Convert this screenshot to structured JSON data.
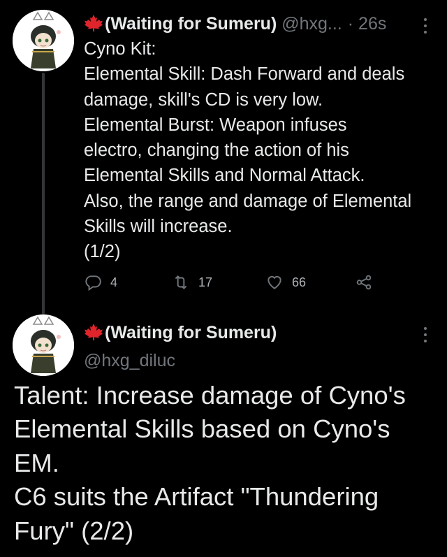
{
  "colors": {
    "background": "#000000",
    "text": "#e7e9ea",
    "secondary": "#71767b",
    "thread_line": "#333639",
    "flag_red": "#e0242b"
  },
  "tweet1": {
    "display_name": "(Waiting for Sumeru)",
    "handle": "@hxg...",
    "separator": "·",
    "time": "26s",
    "body_lines": [
      "Cyno Kit:",
      "Elemental Skill: Dash Forward and deals",
      "damage, skill's CD is very low.",
      "Elemental Burst: Weapon infuses",
      "electro, changing the action of his",
      "Elemental Skills and Normal Attack.",
      "Also, the range and damage of Elemental",
      "Skills will increase.",
      "(1/2)"
    ],
    "actions": {
      "reply": {
        "icon": "reply-icon",
        "count": "4"
      },
      "retweet": {
        "icon": "retweet-icon",
        "count": "17"
      },
      "like": {
        "icon": "heart-icon",
        "count": "66"
      },
      "share": {
        "icon": "share-icon"
      }
    }
  },
  "tweet2": {
    "display_name": "(Waiting for Sumeru)",
    "handle": "@hxg_diluc",
    "body_lines": [
      "Talent: Increase damage of Cyno's",
      "Elemental Skills based on Cyno's",
      "EM.",
      "C6 suits the Artifact \"Thundering",
      "Fury\" (2/2)"
    ]
  }
}
